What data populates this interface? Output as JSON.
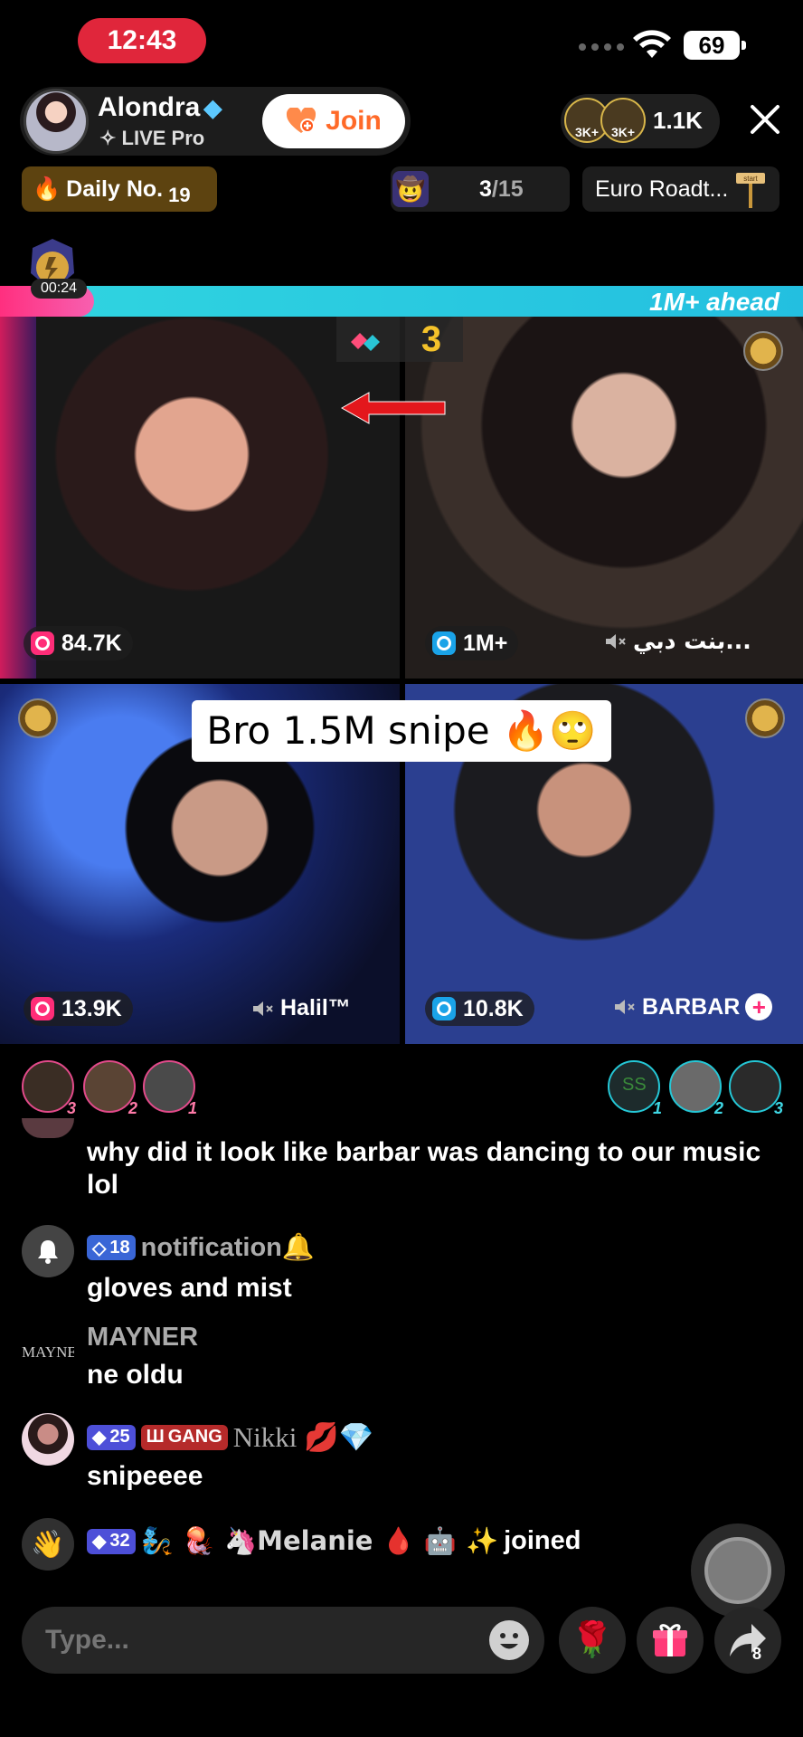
{
  "status_bar": {
    "time": "12:43",
    "battery": "69"
  },
  "host": {
    "name": "Alondra",
    "subtitle": "✧ LIVE Pro",
    "join_label": "Join"
  },
  "viewers": {
    "count": "1.1K",
    "avatars": [
      "3K+",
      "3K+"
    ]
  },
  "daily": {
    "label": "Daily No.",
    "number": "19"
  },
  "quest": {
    "progress": "3",
    "total": "/15"
  },
  "road_trip": {
    "label": "Euro Roadt..."
  },
  "signpost_text": "start",
  "battle": {
    "timer": "00:24",
    "ahead_text": "1M+ ahead",
    "rank": "3"
  },
  "tiles": [
    {
      "score": "84.7K",
      "name": ""
    },
    {
      "score": "1M+",
      "name": "بنت دبي..."
    },
    {
      "score": "13.9K",
      "name": "Halil™"
    },
    {
      "score": "10.8K",
      "name": "BARBAR"
    }
  ],
  "caption": "Bro 1.5M snipe 🔥🙄",
  "gifters_left": [
    "3",
    "2",
    "1"
  ],
  "gifters_right": [
    "1",
    "2",
    "3"
  ],
  "gifter_right_initials": "SS",
  "chat": {
    "msg1_text": "why did it look like barbar was dancing to our music lol",
    "msg2_level": "18",
    "msg2_name": "notification🔔",
    "msg2_text": "gloves and mist",
    "msg3_avatar_text": "MAYNEI",
    "msg3_name": "MAYNER",
    "msg3_text": "ne oldu",
    "msg4_level": "25",
    "msg4_gang": "GANG",
    "msg4_name": "Nikki 💋💎",
    "msg4_text": "snipeeee",
    "join_level": "32",
    "join_name": "🧞 🪼 🦄Melanie 🩸 🤖 ✨",
    "join_text": "joined"
  },
  "input": {
    "placeholder": "Type..."
  },
  "share_count": "8",
  "colors": {
    "accent_pink": "#ff2d78",
    "accent_teal": "#23bfe0",
    "status_red": "#e0263b",
    "join_orange": "#ff6a28"
  }
}
